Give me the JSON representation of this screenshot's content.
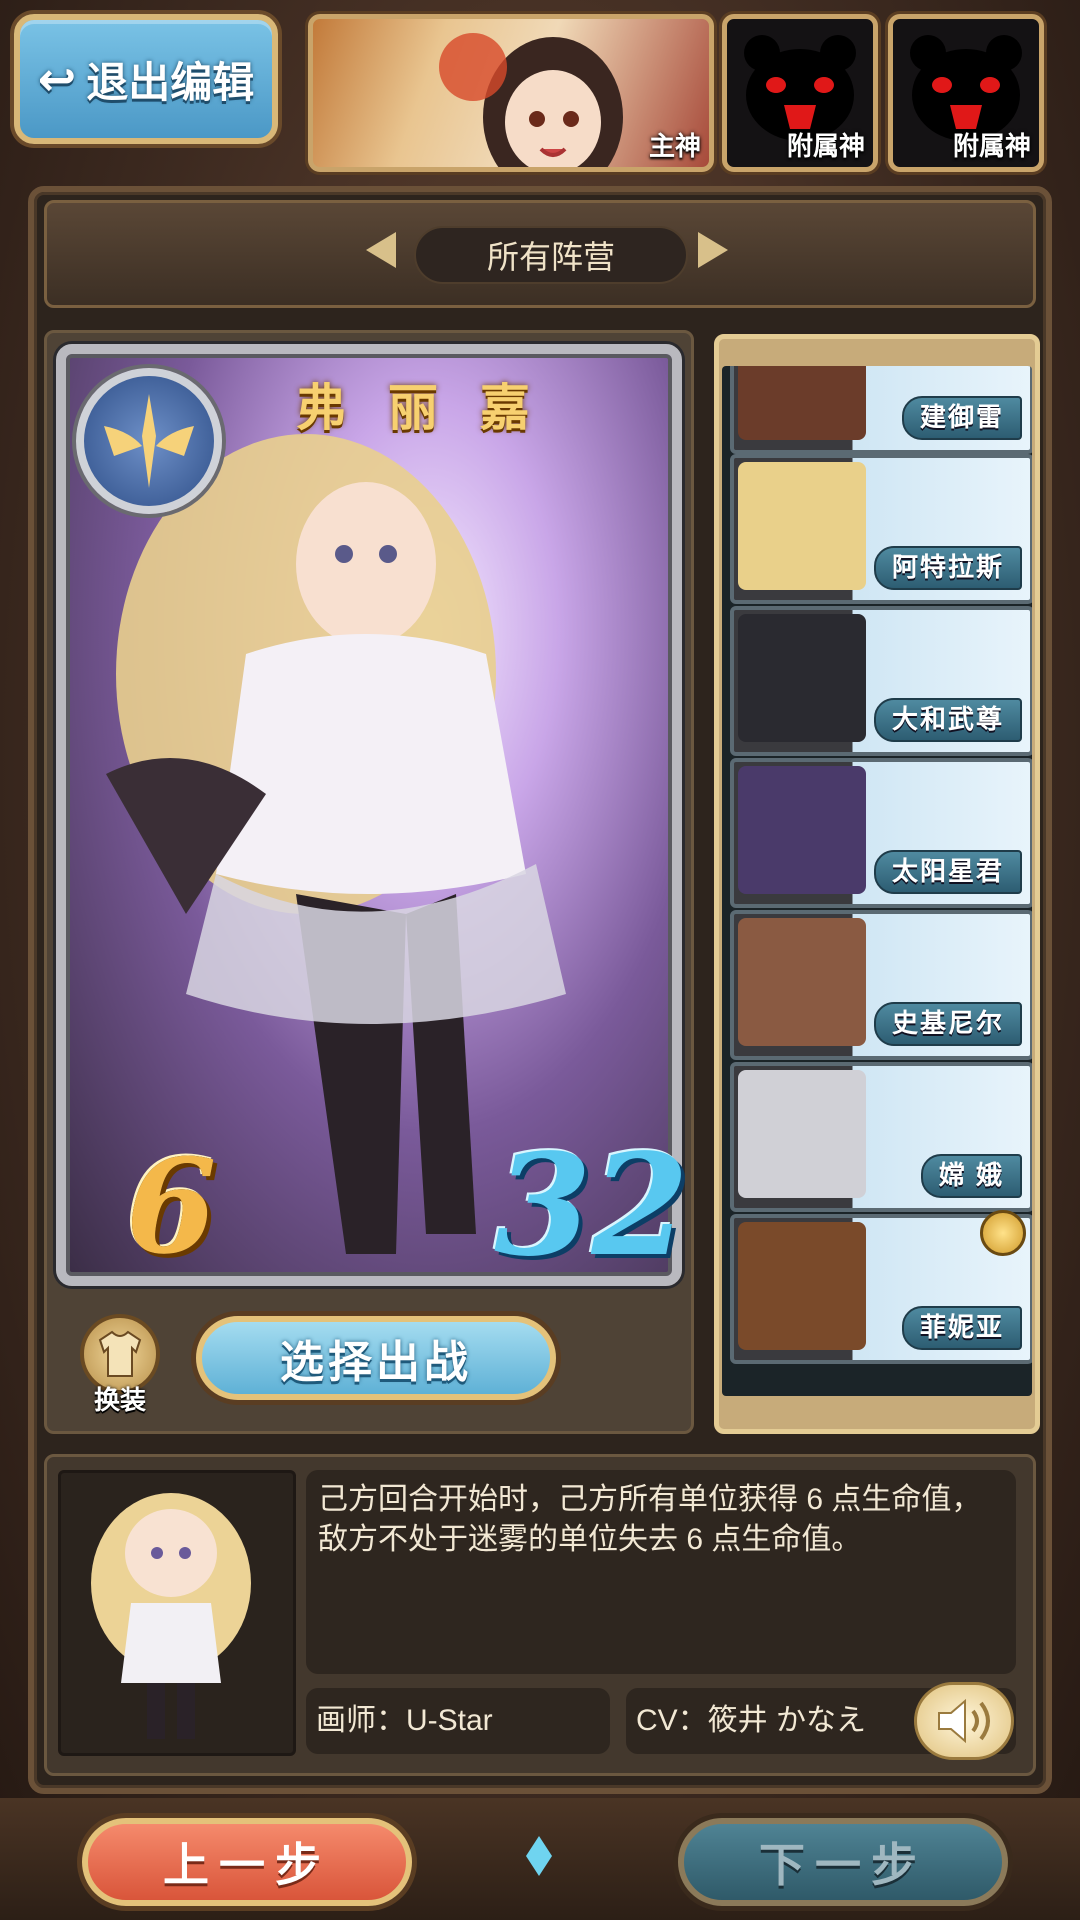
{
  "top_bar": {
    "exit_label": "退出编辑",
    "slots": [
      {
        "label": "主神"
      },
      {
        "label": "附属神"
      },
      {
        "label": "附属神"
      }
    ]
  },
  "faction": {
    "current": "所有阵营"
  },
  "card": {
    "name": "弗 丽 嘉",
    "cost": "6",
    "hp": "32",
    "skin_label": "换装",
    "select_label": "选择出战"
  },
  "hero_list": [
    {
      "name": "建御雷",
      "face_color": "#6b3c2a"
    },
    {
      "name": "阿特拉斯",
      "face_color": "#e9d08a"
    },
    {
      "name": "大和武尊",
      "face_color": "#2a2a30"
    },
    {
      "name": "太阳星君",
      "face_color": "#4a3a6a"
    },
    {
      "name": "史基尼尔",
      "face_color": "#8a5a42"
    },
    {
      "name": "嫦 娥",
      "face_color": "#d0d0d6"
    },
    {
      "name": "菲妮亚",
      "face_color": "#7a4a2a"
    }
  ],
  "info": {
    "skill": "己方回合开始时，己方所有单位获得 6 点生命值，敌方不处于迷雾的单位失去 6 点生命值。",
    "artist": "画师：U-Star",
    "cv": "CV：筱井 かなえ"
  },
  "nav": {
    "prev_label": "上一步",
    "next_label": "下一步"
  },
  "colors": {
    "accent_blue": "#5fb1d6",
    "accent_red": "#d9553a",
    "gold": "#e4c27a"
  }
}
